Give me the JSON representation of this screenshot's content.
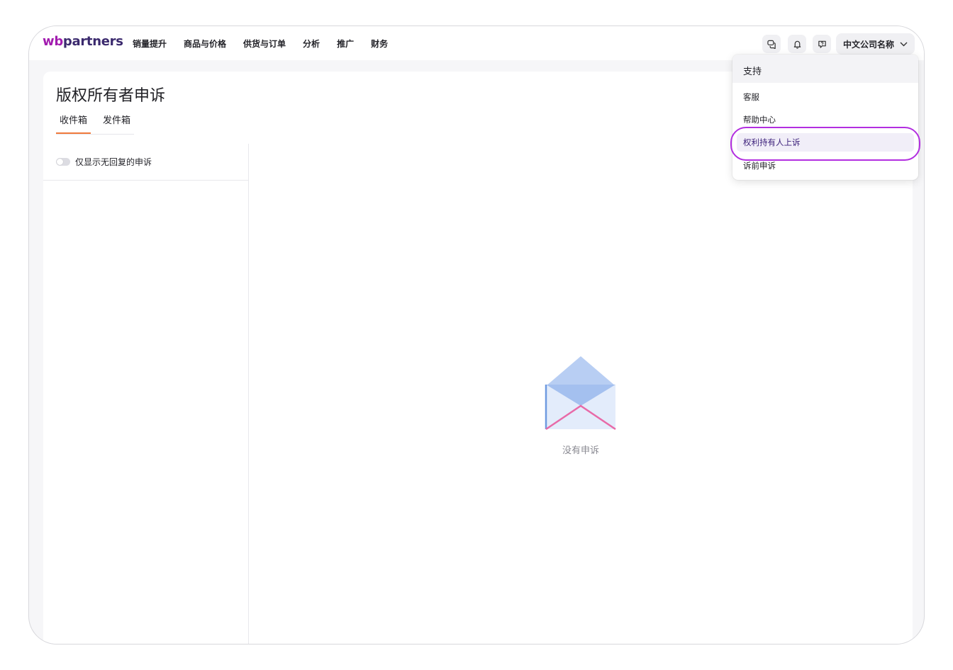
{
  "brand": {
    "logo_prefix": "wb",
    "logo_suffix": "partners",
    "accent": "#a21caf"
  },
  "nav": {
    "items": [
      {
        "label": "销量提升"
      },
      {
        "label": "商品与价格"
      },
      {
        "label": "供货与订单"
      },
      {
        "label": "分析"
      },
      {
        "label": "推广"
      },
      {
        "label": "财务"
      }
    ]
  },
  "header": {
    "icons": [
      "chat-icon",
      "bell-icon",
      "support-icon"
    ],
    "company_name": "中文公司名称"
  },
  "page": {
    "title": "版权所有者申诉",
    "tabs": [
      {
        "label": "收件箱",
        "active": true
      },
      {
        "label": "发件箱",
        "active": false
      }
    ],
    "filter_label": "仅显示无回复的申诉",
    "empty_text": "没有申诉",
    "tab_accent": "#f07a3c"
  },
  "support_menu": {
    "title": "支持",
    "items": [
      {
        "label": "客服"
      },
      {
        "label": "帮助中心"
      },
      {
        "label": "权利持有人上诉",
        "highlighted": true
      },
      {
        "label": "诉前申诉"
      }
    ],
    "highlight_ring_color": "#b22ee0"
  },
  "help_button": {
    "label": "?"
  }
}
